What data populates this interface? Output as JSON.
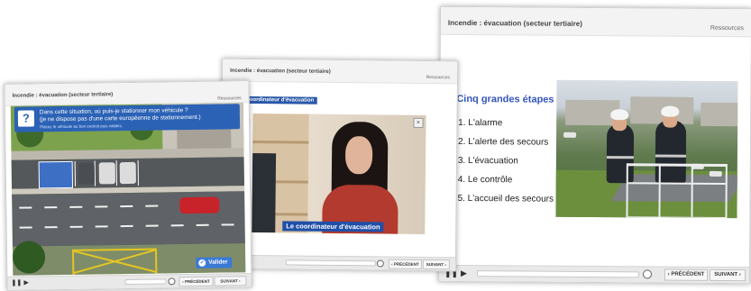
{
  "window_back": {
    "title": "Incendie : évacuation (secteur tertiaire)",
    "resources_label": "Ressources",
    "heading": "Cinq grandes étapes :",
    "steps": [
      "1. L'alarme",
      "2. L'alerte des secours",
      "3. L'évacuation",
      "4. Le contrôle",
      "5. L'accueil des secours"
    ],
    "prev_label": "‹ PRÉCÉDENT",
    "next_label": "SUIVANT ›"
  },
  "window_middle": {
    "title": "Incendie : évacuation (secteur tertiaire)",
    "resources_label": "Ressources",
    "section_tag": "Le coordinateur d'évacuation",
    "video_caption": "Le coordinateur d'évacuation",
    "prev_label": "‹ PRÉCÉDENT",
    "next_label": "SUIVANT ›"
  },
  "window_front": {
    "title": "Incendie : évacuation (secteur tertiaire)",
    "resources_label": "Ressources",
    "question_icon": "?",
    "question_line1": "Dans cette situation, où puis-je stationner mon véhicule ?",
    "question_line2": "(je ne dispose pas d'une carte européenne de stationnement.)",
    "hint": "Placez le véhicule au bon endroit puis validez.",
    "validate_label": "Valider",
    "prev_label": "‹ PRÉCÉDENT",
    "next_label": "SUIVANT ›"
  },
  "controls": {
    "play_glyph": "▶",
    "pause_glyph": "❚❚",
    "knob_glyph": ""
  },
  "colors": {
    "accent_blue": "#2b62b5",
    "heading_blue": "#3355bb",
    "caption_blue": "#1f4fa8"
  }
}
